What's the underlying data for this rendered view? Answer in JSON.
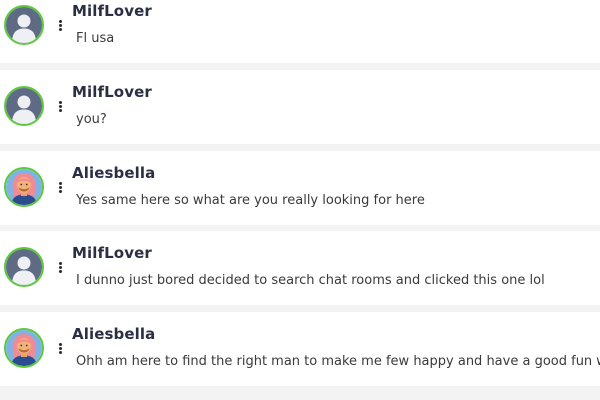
{
  "colors": {
    "avatar_ring": "#5cc93c",
    "default_avatar_bg": "#5f6a84",
    "female_avatar_bg": "#7fb3e6",
    "name_color": "#2a2f45"
  },
  "messages": [
    {
      "username": "MilfLover",
      "avatar": "default-user-icon",
      "text": "Fl usa"
    },
    {
      "username": "MilfLover",
      "avatar": "default-user-icon",
      "text": "you?"
    },
    {
      "username": "Aliesbella",
      "avatar": "female-user-icon",
      "text": "Yes same here so what are you really looking for here"
    },
    {
      "username": "MilfLover",
      "avatar": "default-user-icon",
      "text": "I dunno just bored decided to search chat rooms and clicked this one lol"
    },
    {
      "username": "Aliesbella",
      "avatar": "female-user-icon",
      "text": "Ohh am here to find the right man to make me few happy and have a good fun with"
    }
  ]
}
